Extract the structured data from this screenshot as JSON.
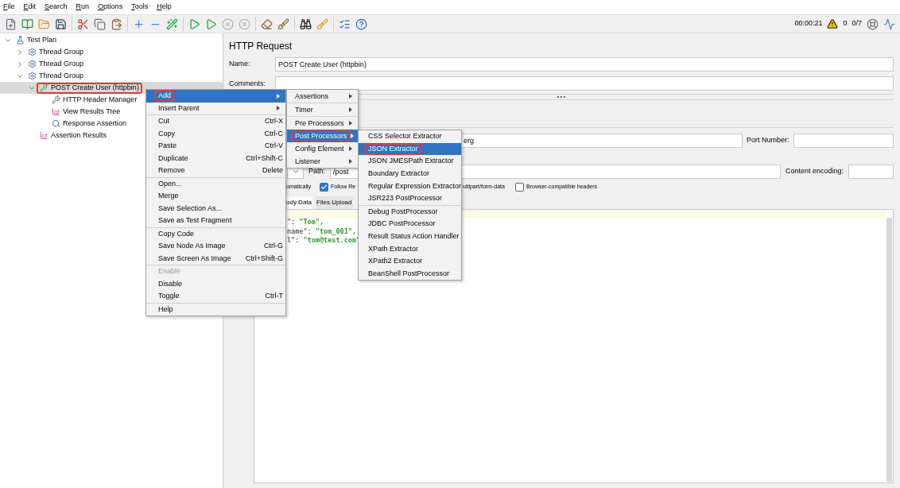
{
  "menu_bar": [
    "File",
    "Edit",
    "Search",
    "Run",
    "Options",
    "Tools",
    "Help"
  ],
  "status": {
    "elapsed": "00:00:21",
    "warnings": "0",
    "threads": "0/7"
  },
  "tree": [
    {
      "label": "Test Plan",
      "kind": "plan",
      "expanded": true,
      "selected": false,
      "highlighted": false,
      "children": [
        {
          "label": "Thread Group",
          "kind": "group",
          "expanded": false,
          "selected": false,
          "highlighted": false
        },
        {
          "label": "Thread Group",
          "kind": "group",
          "expanded": false,
          "selected": false,
          "highlighted": false
        },
        {
          "label": "Thread Group",
          "kind": "group",
          "expanded": true,
          "selected": false,
          "highlighted": false,
          "children": [
            {
              "label": "POST Create User (httpbin)",
              "kind": "sampler",
              "expanded": true,
              "selected": true,
              "highlighted": true,
              "children": [
                {
                  "label": "HTTP Header Manager",
                  "kind": "config",
                  "selected": false,
                  "highlighted": false
                },
                {
                  "label": "View Results Tree",
                  "kind": "listener",
                  "selected": false,
                  "highlighted": false
                },
                {
                  "label": "Response Assertion",
                  "kind": "assertion",
                  "selected": false,
                  "highlighted": false
                }
              ]
            },
            {
              "label": "Assertion Results",
              "kind": "listener",
              "selected": false,
              "highlighted": false
            }
          ]
        }
      ]
    }
  ],
  "panel": {
    "title": "HTTP Request",
    "name_label": "Name:",
    "name_value": "POST Create User (httpbin)",
    "comments_label": "Comments:",
    "server_value": "erg",
    "port_label": "Port Number:",
    "path_label": "Path:",
    "path_value": "/post",
    "encoding_label": "Content encoding:",
    "options": [
      {
        "label": "omatically"
      },
      {
        "label": "Follow Re",
        "checked": true
      },
      {
        "label": "ultipart/form-data"
      },
      {
        "label": "Browser-compatible headers",
        "checked": false
      }
    ],
    "tabs": [
      {
        "label": "ody Data",
        "selected": true
      },
      {
        "label": "Files Upload",
        "selected": false
      }
    ],
    "code_lines": [
      {
        "key": "\": ",
        "value": "\"Tom\","
      },
      {
        "key": "name\": ",
        "value": "\"tom_001\","
      },
      {
        "key": "l\": ",
        "value": "\"tom@test.com\""
      }
    ]
  },
  "context_menu": [
    [
      {
        "label": "Add",
        "submenu": true,
        "selected": true,
        "highlighted": true,
        "disabled": false
      },
      {
        "label": "Insert Parent",
        "submenu": true,
        "selected": false,
        "highlighted": false,
        "disabled": false
      }
    ],
    [
      {
        "label": "Cut",
        "shortcut": "Ctrl-X",
        "selected": false,
        "highlighted": false,
        "disabled": false
      },
      {
        "label": "Copy",
        "shortcut": "Ctrl-C",
        "selected": false,
        "highlighted": false,
        "disabled": false
      },
      {
        "label": "Paste",
        "shortcut": "Ctrl-V",
        "selected": false,
        "highlighted": false,
        "disabled": false
      },
      {
        "label": "Duplicate",
        "shortcut": "Ctrl+Shift-C",
        "selected": false,
        "highlighted": false,
        "disabled": false
      },
      {
        "label": "Remove",
        "shortcut": "Delete",
        "selected": false,
        "highlighted": false,
        "disabled": false
      }
    ],
    [
      {
        "label": "Open...",
        "selected": false,
        "highlighted": false,
        "disabled": false
      },
      {
        "label": "Merge",
        "selected": false,
        "highlighted": false,
        "disabled": false
      },
      {
        "label": "Save Selection As...",
        "selected": false,
        "highlighted": false,
        "disabled": false
      },
      {
        "label": "Save as Test Fragment",
        "selected": false,
        "highlighted": false,
        "disabled": false
      }
    ],
    [
      {
        "label": "Copy Code",
        "selected": false,
        "highlighted": false,
        "disabled": false
      },
      {
        "label": "Save Node As Image",
        "shortcut": "Ctrl-G",
        "selected": false,
        "highlighted": false,
        "disabled": false
      },
      {
        "label": "Save Screen As Image",
        "shortcut": "Ctrl+Shift-G",
        "selected": false,
        "highlighted": false,
        "disabled": false
      }
    ],
    [
      {
        "label": "Enable",
        "selected": false,
        "highlighted": false,
        "disabled": true
      },
      {
        "label": "Disable",
        "selected": false,
        "highlighted": false,
        "disabled": false
      },
      {
        "label": "Toggle",
        "shortcut": "Ctrl-T",
        "selected": false,
        "highlighted": false,
        "disabled": false
      }
    ],
    [
      {
        "label": "Help",
        "selected": false,
        "highlighted": false,
        "disabled": false
      }
    ]
  ],
  "add_menu": [
    [
      {
        "label": "Assertions",
        "submenu": true,
        "selected": false,
        "highlighted": false
      }
    ],
    [
      {
        "label": "Timer",
        "submenu": true,
        "selected": false,
        "highlighted": false
      }
    ],
    [
      {
        "label": "Pre Processors",
        "submenu": true,
        "selected": false,
        "highlighted": false
      },
      {
        "label": "Post Processors",
        "submenu": true,
        "selected": true,
        "highlighted": true
      },
      {
        "label": "Config Element",
        "submenu": true,
        "selected": false,
        "highlighted": false
      },
      {
        "label": "Listener",
        "submenu": true,
        "selected": false,
        "highlighted": false
      }
    ]
  ],
  "post_processors_menu": [
    [
      {
        "label": "CSS Selector Extractor",
        "selected": false,
        "highlighted": false
      },
      {
        "label": "JSON Extractor",
        "selected": true,
        "highlighted": true
      },
      {
        "label": "JSON JMESPath Extractor",
        "selected": false,
        "highlighted": false
      },
      {
        "label": "Boundary Extractor",
        "selected": false,
        "highlighted": false
      },
      {
        "label": "Regular Expression Extractor",
        "selected": false,
        "highlighted": false
      },
      {
        "label": "JSR223 PostProcessor",
        "selected": false,
        "highlighted": false
      }
    ],
    [
      {
        "label": "Debug PostProcessor",
        "selected": false,
        "highlighted": false
      },
      {
        "label": "JDBC PostProcessor",
        "selected": false,
        "highlighted": false
      },
      {
        "label": "Result Status Action Handler",
        "selected": false,
        "highlighted": false
      },
      {
        "label": "XPath Extractor",
        "selected": false,
        "highlighted": false
      },
      {
        "label": "XPath2 Extractor",
        "selected": false,
        "highlighted": false
      },
      {
        "label": "BeanShell PostProcessor",
        "selected": false,
        "highlighted": false
      }
    ]
  ]
}
